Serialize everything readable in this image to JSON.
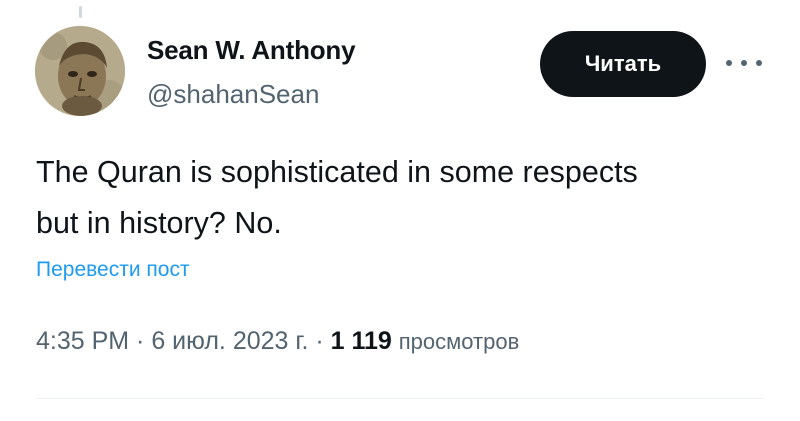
{
  "tweet": {
    "author": {
      "display_name": "Sean W. Anthony",
      "handle": "@shahanSean",
      "avatar_icon": "portrait-avatar"
    },
    "follow_button_label": "Читать",
    "more_icon": "more-horizontal-icon",
    "text_lines": [
      "The Quran is sophisticated in some respects",
      "but in history? No."
    ],
    "translate_label": "Перевести пост",
    "time": "4:35 PM",
    "separator": " · ",
    "date": "6 июл. 2023 г.",
    "views_count": "1 119",
    "views_label": "просмотров"
  },
  "colors": {
    "text_primary": "#0f1419",
    "text_secondary": "#536471",
    "link": "#1d9bf0",
    "button_bg": "#0f1419",
    "button_text": "#ffffff",
    "divider": "#eff3f4"
  }
}
